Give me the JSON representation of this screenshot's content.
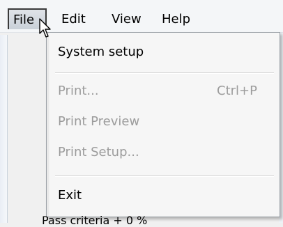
{
  "menubar": {
    "items": [
      {
        "label": "File",
        "active": true
      },
      {
        "label": "Edit"
      },
      {
        "label": "View"
      },
      {
        "label": "Help"
      }
    ]
  },
  "file_menu": {
    "items": [
      {
        "label": "System setup",
        "enabled": true
      },
      {
        "label": "Print...",
        "shortcut": "Ctrl+P",
        "enabled": false
      },
      {
        "label": "Print Preview",
        "enabled": false
      },
      {
        "label": "Print Setup...",
        "enabled": false
      },
      {
        "label": "Exit",
        "enabled": true
      }
    ]
  },
  "background": {
    "partial_text": "Pass criteria     + 0 %"
  },
  "icons": {
    "cursor": "mouse-pointer-icon"
  }
}
